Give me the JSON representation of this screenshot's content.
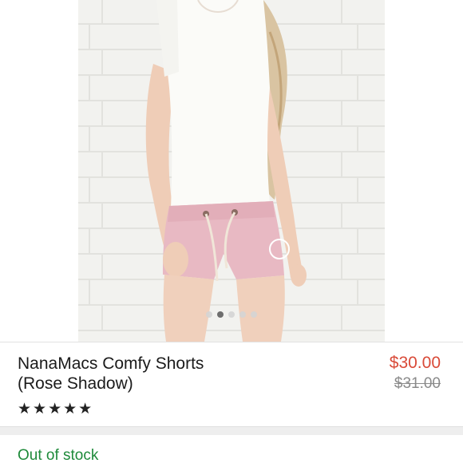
{
  "gallery": {
    "image_alt": "Model wearing pink comfy shorts and white tee",
    "dots_count": 5,
    "active_dot_index": 1
  },
  "product": {
    "title_line1": "NanaMacs Comfy Shorts",
    "title_line2": "(Rose Shadow)",
    "rating_display": "★★★★★",
    "rating_value": 5,
    "price": "$30.00",
    "original_price": "$31.00"
  },
  "availability": {
    "status": "Out of stock"
  },
  "colors": {
    "price": "#d94a38",
    "stock": "#1e8a3a",
    "shorts": "#e8b9c3",
    "brick": "#f1f1ee"
  }
}
